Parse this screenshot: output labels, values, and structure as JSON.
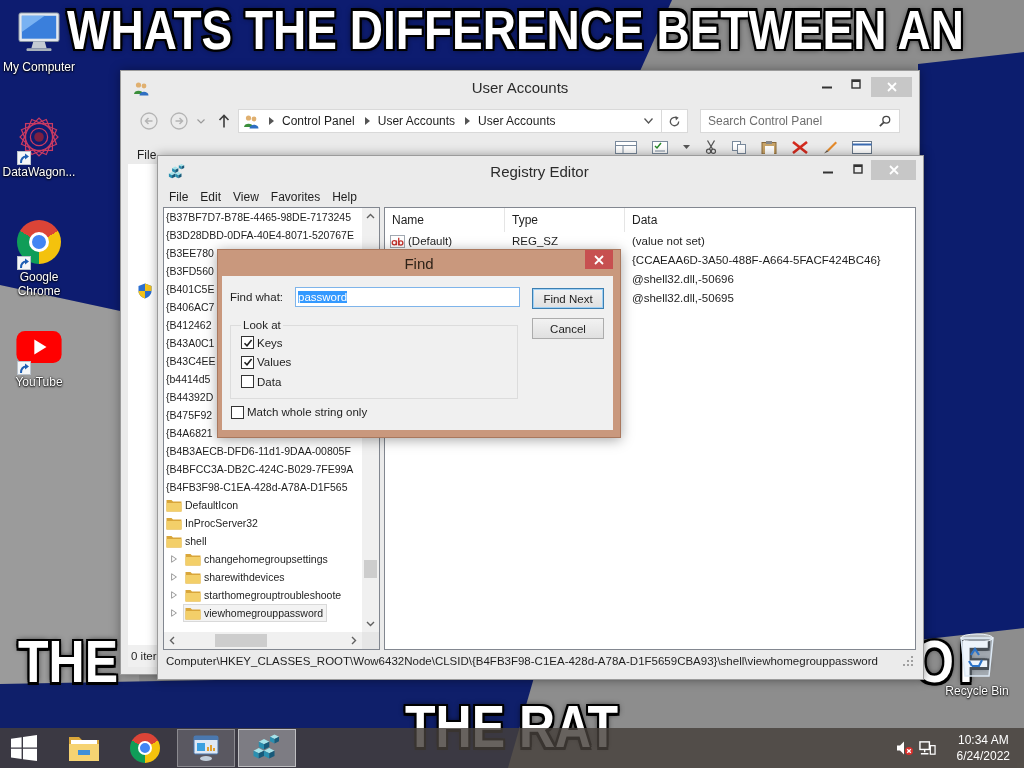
{
  "desktop": {
    "captions": [
      {
        "kind": "top",
        "text": "WHATS THE DIFFERENCE BETWEEN AN"
      },
      {
        "kind": "bottom-left",
        "text": "THE"
      },
      {
        "kind": "bottom-right",
        "text": "OF"
      },
      {
        "kind": "bottom",
        "text": "THE RAT"
      }
    ],
    "icons": [
      {
        "kind": "computer",
        "label": "My Computer",
        "shortcut": false
      },
      {
        "kind": "star-logo",
        "label": "DataWagon...",
        "shortcut": true
      },
      {
        "kind": "chrome",
        "label": "Google Chrome",
        "shortcut": true
      },
      {
        "kind": "youtube",
        "label": "YouTube",
        "shortcut": true
      }
    ],
    "recycle_bin": {
      "label": "Recycle Bin"
    }
  },
  "user_accounts_window": {
    "title": "User Accounts",
    "breadcrumb": [
      "Control Panel",
      "User Accounts",
      "User Accounts"
    ],
    "search": {
      "placeholder": "Search Control Panel"
    },
    "menu": [
      "File"
    ],
    "status_bar": "0 iter"
  },
  "registry_editor": {
    "title": "Registry Editor",
    "menu": [
      "File",
      "Edit",
      "View",
      "Favorites",
      "Help"
    ],
    "tree": [
      {
        "label": "{B37BF7D7-B78E-4465-98DE-7173245",
        "selected": false
      },
      {
        "label": "{B3D28DBD-0DFA-40E4-8071-520767E",
        "selected": false
      },
      {
        "label": "{B3EE780",
        "selected": false
      },
      {
        "label": "{B3FD560",
        "selected": false
      },
      {
        "label": "{B401C5E",
        "selected": false
      },
      {
        "label": "{B406AC7",
        "selected": false
      },
      {
        "label": "{B412462",
        "selected": false
      },
      {
        "label": "{B43A0C1",
        "selected": false
      },
      {
        "label": "{B43C4EE",
        "selected": false
      },
      {
        "label": "{b4414d5",
        "selected": false
      },
      {
        "label": "{B44392D",
        "selected": false
      },
      {
        "label": "{B475F92",
        "selected": false
      },
      {
        "label": "{B4A6821",
        "selected": false
      },
      {
        "label": "{B4B3AECB-DFD6-11d1-9DAA-00805F",
        "selected": false
      },
      {
        "label": "{B4BFCC3A-DB2C-424C-B029-7FE99A",
        "selected": false
      },
      {
        "label": "{B4FB3F98-C1EA-428d-A78A-D1F565",
        "selected": false,
        "children": [
          {
            "label": "DefaultIcon",
            "selected": false
          },
          {
            "label": "InProcServer32",
            "selected": false
          },
          {
            "label": "shell",
            "selected": false,
            "children": [
              {
                "label": "changehomegroupsettings",
                "selected": false,
                "expanded": false
              },
              {
                "label": "sharewithdevices",
                "selected": false,
                "expanded": false
              },
              {
                "label": "starthomegrouptroubleshoote",
                "selected": false,
                "expanded": false
              },
              {
                "label": "viewhomegrouppassword",
                "selected": true,
                "expanded": false
              }
            ]
          }
        ]
      }
    ],
    "columns": [
      "Name",
      "Type",
      "Data"
    ],
    "values": [
      {
        "name": "(Default)",
        "type": "REG_SZ",
        "data": "(value not set)"
      },
      {
        "data": "{CCAEAA6D-3A50-488F-A664-5FACF424BC46}"
      },
      {
        "data": "@shell32.dll,-50696"
      },
      {
        "data": "@shell32.dll,-50695"
      }
    ],
    "status_bar": "Computer\\HKEY_CLASSES_ROOT\\Wow6432Node\\CLSID\\{B4FB3F98-C1EA-428d-A78A-D1F5659CBA93}\\shell\\viewhomegrouppassword"
  },
  "find_dialog": {
    "title": "Find",
    "find_what": {
      "label": "Find what:",
      "value": "password",
      "value_selected": true
    },
    "look_at": {
      "label": "Look at",
      "options": [
        {
          "label": "Keys",
          "checked": true
        },
        {
          "label": "Values",
          "checked": true
        },
        {
          "label": "Data",
          "checked": false
        }
      ]
    },
    "match_whole_string": {
      "label": "Match whole string only",
      "checked": false
    },
    "buttons": [
      {
        "label": "Find Next",
        "default": true
      },
      {
        "label": "Cancel",
        "default": false
      }
    ]
  },
  "taskbar": {
    "apps": [
      {
        "kind": "explorer",
        "open": false,
        "selected": false
      },
      {
        "kind": "chrome",
        "open": false,
        "selected": false
      },
      {
        "kind": "control-panel",
        "open": true,
        "selected": false
      },
      {
        "kind": "registry",
        "open": true,
        "selected": true
      }
    ],
    "volume": {
      "muted": true
    },
    "clock": {
      "time": "10:34 AM",
      "date": "6/24/2022"
    }
  }
}
